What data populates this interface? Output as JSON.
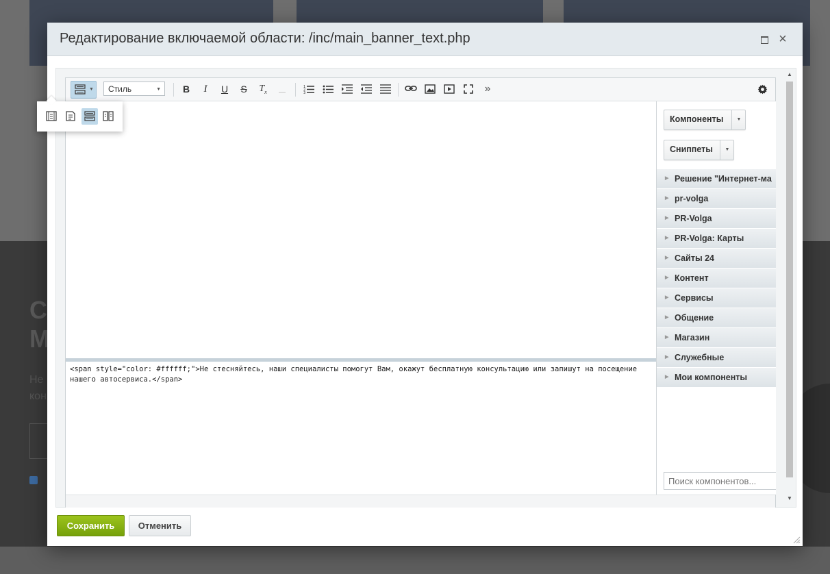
{
  "dialog": {
    "title": "Редактирование включаемой области: /inc/main_banner_text.php"
  },
  "toolbar": {
    "style_select_label": "Стиль",
    "more_label": "»"
  },
  "view_modes": [
    "wysiwyg-mode-icon",
    "code-mode-icon",
    "split-horizontal-icon",
    "split-vertical-icon"
  ],
  "code": "<span style=\"color: #ffffff;\">Не стесняйтесь, наши специалисты помогут Вам, окажут бесплатную консультацию или запишут на посещение нашего автосервиса.</span>",
  "side_panel": {
    "components_label": "Компоненты",
    "snippets_label": "Сниппеты",
    "groups": [
      "Решение \"Интернет-ма",
      "pr-volga",
      "PR-Volga",
      "PR-Volga: Карты",
      "Сайты 24",
      "Контент",
      "Сервисы",
      "Общение",
      "Магазин",
      "Служебные",
      "Мои компоненты"
    ],
    "search_placeholder": "Поиск компонентов..."
  },
  "buttons": {
    "save": "Сохранить",
    "cancel": "Отменить"
  },
  "colors": {
    "save_button": "#8ab415",
    "active_toggle": "#bfd9ea",
    "header_bg": "#e4eaee"
  }
}
